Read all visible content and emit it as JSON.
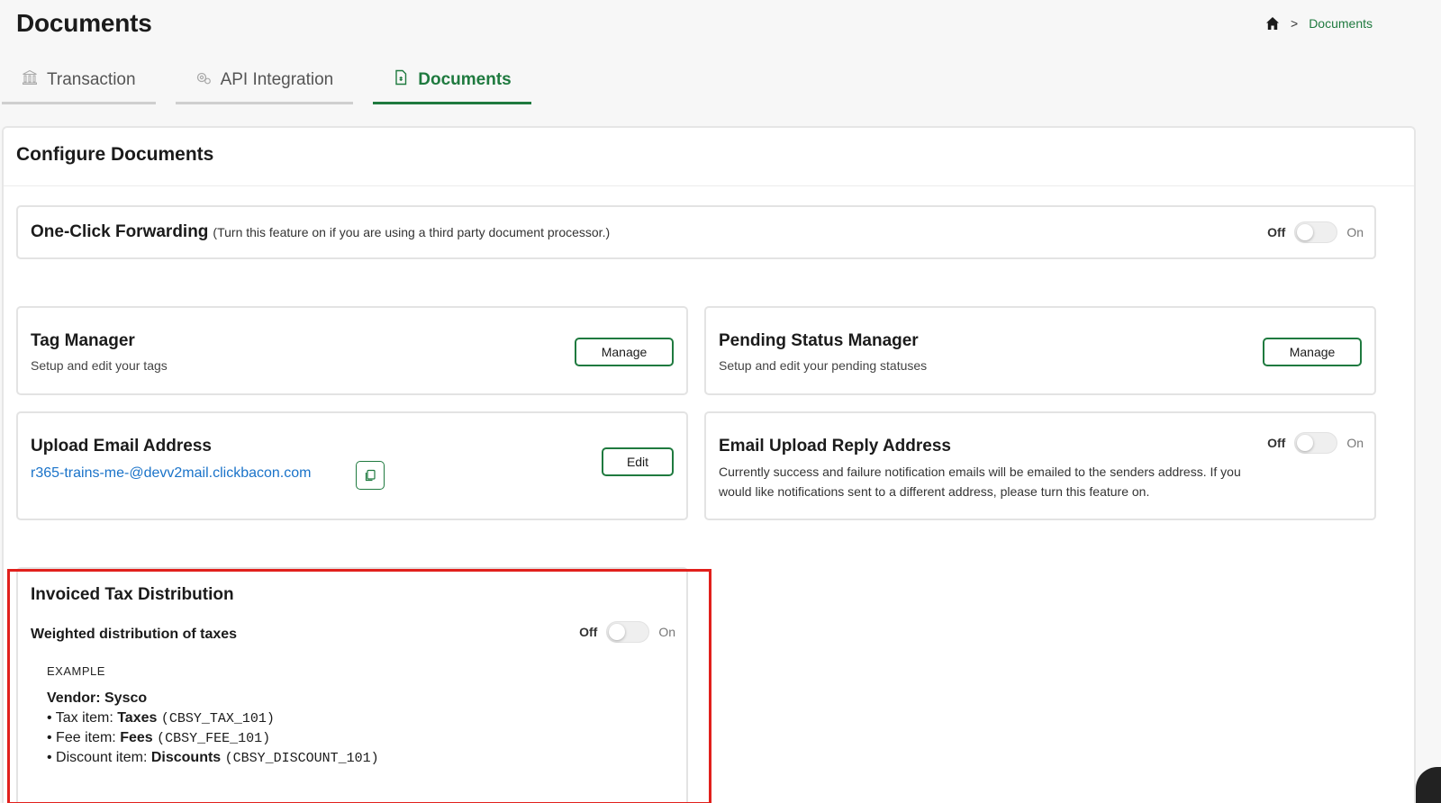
{
  "header": {
    "title": "Documents",
    "breadcrumb": {
      "home_icon": "home-icon",
      "separator": ">",
      "current": "Documents"
    }
  },
  "tabs": [
    {
      "label": "Transaction",
      "icon": "bank-icon",
      "active": false
    },
    {
      "label": "API Integration",
      "icon": "gear-icon",
      "active": false
    },
    {
      "label": "Documents",
      "icon": "document-icon",
      "active": true
    }
  ],
  "configure": {
    "title": "Configure Documents",
    "one_click": {
      "title": "One-Click Forwarding",
      "note": "(Turn this feature on if you are using a third party document processor.)",
      "off_label": "Off",
      "on_label": "On",
      "enabled": false
    },
    "tag_manager": {
      "title": "Tag Manager",
      "subtitle": "Setup and edit your tags",
      "button": "Manage"
    },
    "pending_status": {
      "title": "Pending Status Manager",
      "subtitle": "Setup and edit your pending statuses",
      "button": "Manage"
    },
    "upload_email": {
      "title": "Upload Email Address",
      "email": "r365-trains-me-@devv2mail.clickbacon.com",
      "copy_icon": "copy-icon",
      "button": "Edit"
    },
    "reply_address": {
      "title": "Email Upload Reply Address",
      "description": "Currently success and failure notification emails will be emailed to the senders address. If you would like notifications sent to a different address, please turn this feature on.",
      "off_label": "Off",
      "on_label": "On",
      "enabled": false
    },
    "tax_distribution": {
      "title": "Invoiced Tax Distribution",
      "weighted_label": "Weighted distribution of taxes",
      "off_label": "Off",
      "on_label": "On",
      "enabled": false,
      "example": {
        "label": "EXAMPLE",
        "vendor": "Vendor: Sysco",
        "items": [
          {
            "prefix": "• Tax item: ",
            "name": "Taxes",
            "code": "(CBSY_TAX_101)"
          },
          {
            "prefix": "• Fee item: ",
            "name": "Fees",
            "code": "(CBSY_FEE_101)"
          },
          {
            "prefix": "• Discount item: ",
            "name": "Discounts",
            "code": "(CBSY_DISCOUNT_101)"
          }
        ]
      }
    }
  },
  "colors": {
    "accent": "#1f7a3f",
    "link": "#1a73c9",
    "highlight": "#e1201c"
  }
}
